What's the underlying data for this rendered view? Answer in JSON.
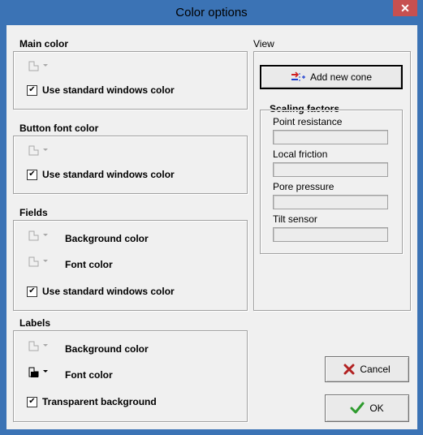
{
  "window": {
    "title": "Color options",
    "close_glyph": "✕"
  },
  "main_color": {
    "title": "Main color",
    "checkbox_label": "Use standard windows color",
    "checked": true
  },
  "button_font_color": {
    "title": "Button font color",
    "checkbox_label": "Use standard windows color",
    "checked": true
  },
  "fields": {
    "title": "Fields",
    "background_label": "Background color",
    "font_label": "Font color",
    "checkbox_label": "Use standard windows color",
    "checked": true
  },
  "labels": {
    "title": "Labels",
    "background_label": "Background color",
    "font_label": "Font color",
    "checkbox_label": "Transparent background",
    "checked": true
  },
  "view": {
    "title": "View",
    "add_cone_label": "Add new cone",
    "scaling": {
      "title": "Scaling factors",
      "items": [
        {
          "label": "Point resistance",
          "value": ""
        },
        {
          "label": "Local friction",
          "value": ""
        },
        {
          "label": "Pore pressure",
          "value": ""
        },
        {
          "label": "Tilt sensor",
          "value": ""
        }
      ]
    }
  },
  "buttons": {
    "cancel_label": "Cancel",
    "ok_label": "OK"
  },
  "check_glyph": "✔",
  "colors": {
    "titlebar": "#3b73b5",
    "close": "#c75050",
    "cancel_x": "#b22222",
    "ok_check": "#2e9b2e",
    "label_font_color": "#000000"
  }
}
